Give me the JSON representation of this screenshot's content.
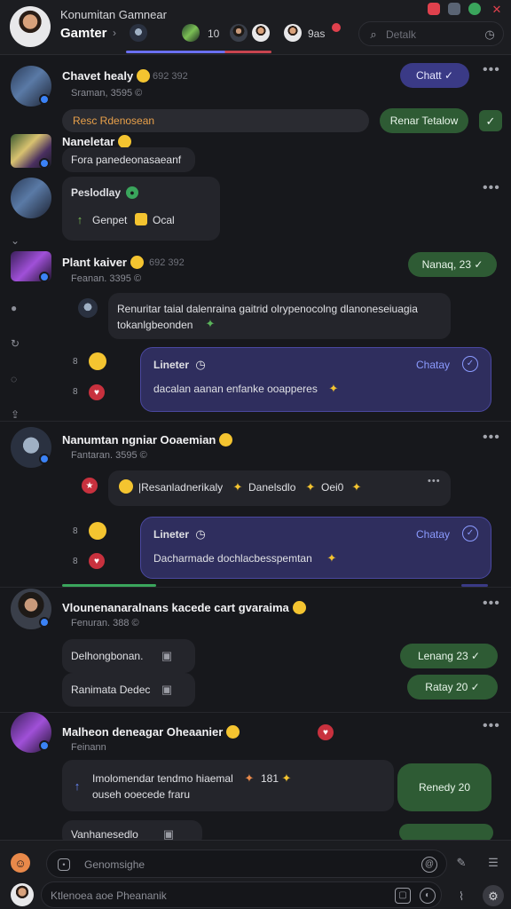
{
  "header": {
    "title_line1": "Konumitan Gamnear",
    "title_line2": "Gamter",
    "chevron": "›",
    "count_label": "10",
    "gas_label": "9as",
    "search_placeholder": "Detalk",
    "window_buttons": {
      "close_color": "#e0414d",
      "shield_color": "#5a6474",
      "green_color": "#3aa55c"
    }
  },
  "sidebar": {
    "icons": [
      "chevron-down-icon",
      "user-icon",
      "refresh-icon",
      "chat-icon",
      "share-icon"
    ]
  },
  "posts": [
    {
      "name": "Chavet healy",
      "time": "692 392",
      "meta": "Sraman, 3595 ©",
      "action_label": "Chatt",
      "banner_text": "Resc Rdenosean",
      "banner_action": "Renar Tetalow"
    },
    {
      "name": "Naneletar",
      "body": "Fora panedeonasaeanf"
    },
    {
      "name": "Peslodlay",
      "body": "Genpet",
      "body2": "Ocal"
    },
    {
      "name": "Plant kaiver",
      "time": "692 392",
      "meta": "Feanan. 3395 ©",
      "action_label": "Nanaq, 23",
      "comment_line1": "Renuritar taial dalenraina gaitrid olrypenocolng dlanoneseiuagia",
      "comment_line2": "tokanlgbeonden",
      "reply_title": "Lineter",
      "reply_action": "Chatay",
      "reply_body": "dacalan aanan enfanke ooapperes",
      "reply_index": "8",
      "reply_index2": "8"
    },
    {
      "name": "Nanumtan ngniar Ooaemian",
      "meta": "Fantaran. 3595 ©",
      "comment": "|Resanladnerikaly",
      "comment_b": "Danelsdlo",
      "comment_c": "Oei0",
      "reply_title": "Lineter",
      "reply_action": "Chatay",
      "reply_body": "Dacharmade dochlacbesspemtan",
      "reply_index": "8",
      "reply_index2": "8"
    },
    {
      "name": "Vlounenanaralnans kacede cart gvaraima",
      "meta": "Fenuran. 388 ©",
      "row1_label": "Delhongbonan.",
      "row1_action": "Lenang 23",
      "row2_label": "Ranimata Dedec",
      "row2_action": "Ratay 20"
    },
    {
      "name": "Malheon deneagar Oheaanier",
      "meta": "Feinann",
      "body_line1": "Imolomendar tendmo hiaemal",
      "body_num": "181",
      "body_line2": "ouseh ooecede fraru",
      "action_label": "Renedy 20",
      "tail_label": "Vanhanesedlo"
    }
  ],
  "composer": {
    "placeholder": "Genomsighe",
    "reply_placeholder": "Ktlenoea aoe Pheananik"
  },
  "colors": {
    "accent_blue": "#6a6ff0",
    "pill_green": "#2e5b34",
    "reply_purple": "#2f2e5e",
    "danger_red": "#e0414d"
  }
}
